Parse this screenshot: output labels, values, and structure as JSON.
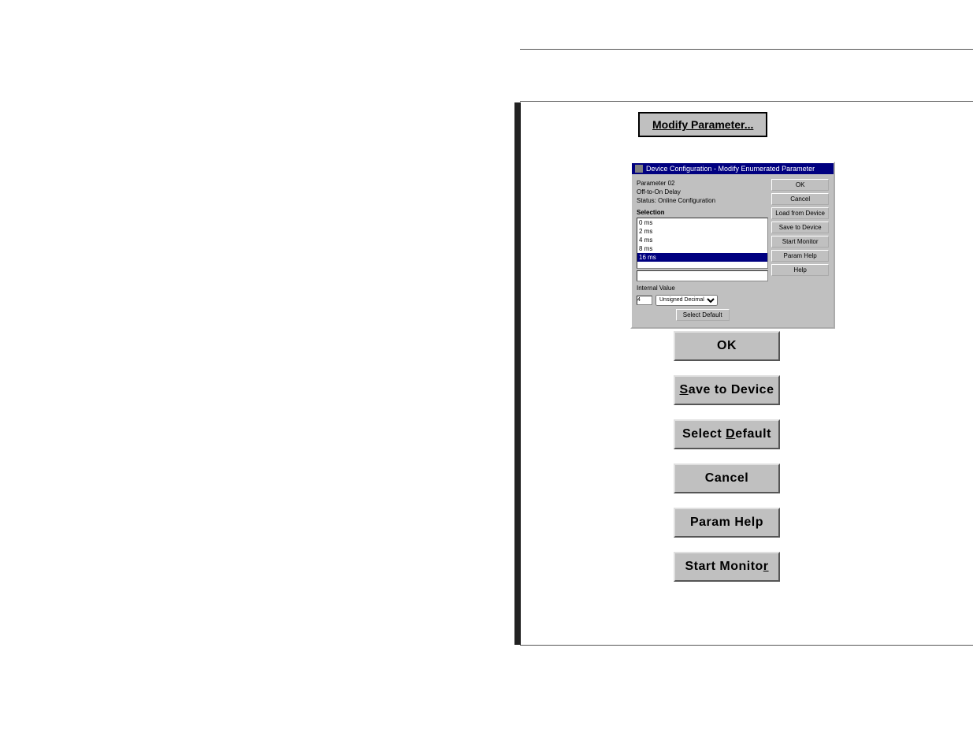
{
  "header": {
    "hr_top": true,
    "hr_mid": true,
    "hr_bottom": true
  },
  "modify_param_button": {
    "label": "Modify Parameter..."
  },
  "dialog": {
    "title": "Device Configuration - Modify Enumerated Parameter",
    "param_number": "Parameter 02",
    "param_name": "Off-to-On Delay",
    "param_status_label": "Status:",
    "param_status_value": "Online Configuration",
    "selection_label": "Selection",
    "list_items": [
      {
        "label": "0 ms",
        "selected": false
      },
      {
        "label": "2 ms",
        "selected": false
      },
      {
        "label": "4 ms",
        "selected": false
      },
      {
        "label": "8 ms",
        "selected": false
      },
      {
        "label": "16 ms",
        "selected": true
      }
    ],
    "internal_value_label": "Internal Value",
    "internal_value": "4",
    "dropdown_value": "Unsigned Decimal",
    "select_default_btn": "Select Default",
    "buttons": {
      "ok": "OK",
      "cancel": "Cancel",
      "load_from_device": "Load from Device",
      "save_to_device": "Save to Device",
      "start_monitor": "Start Monitor",
      "param_help": "Param Help",
      "help": "Help"
    }
  },
  "large_buttons": {
    "ok": "OK",
    "save_to_device": "Save to Device",
    "select_default": "Select Default",
    "cancel": "Cancel",
    "param_help": "Param Help",
    "start_monitor": "Start Monitor"
  }
}
